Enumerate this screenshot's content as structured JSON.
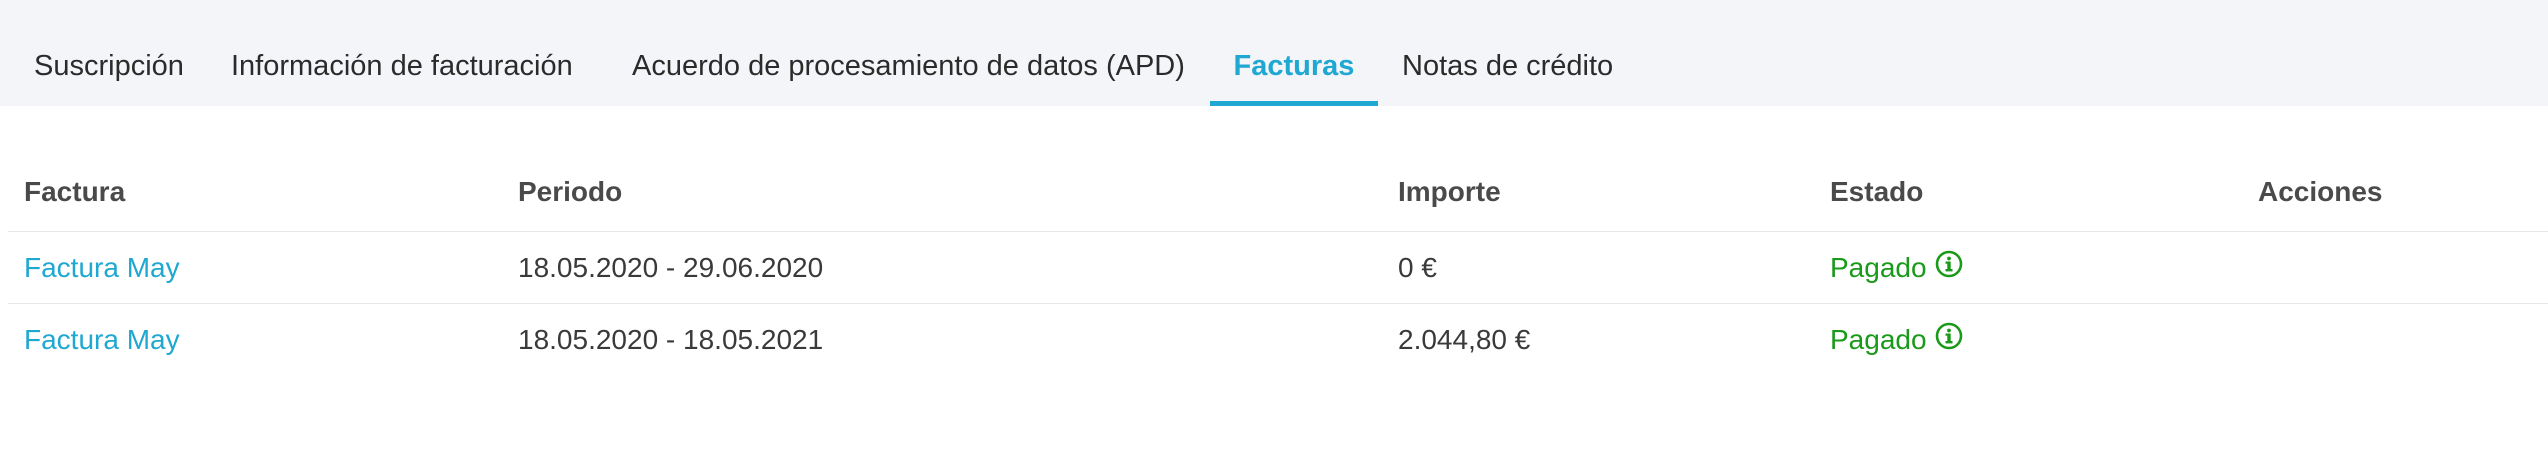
{
  "tabs": [
    {
      "label": "Suscripción",
      "active": false
    },
    {
      "label": "Información de facturación",
      "active": false
    },
    {
      "label": "Acuerdo de procesamiento de datos (APD)",
      "active": false
    },
    {
      "label": "Facturas",
      "active": true
    },
    {
      "label": "Notas de crédito",
      "active": false
    }
  ],
  "table": {
    "columns": [
      "Factura",
      "Periodo",
      "Importe",
      "Estado",
      "Acciones"
    ],
    "rows": [
      {
        "invoice": "Factura May",
        "period": "18.05.2020 - 29.06.2020",
        "amount": "0 €",
        "status": "Pagado",
        "status_icon": "info-icon"
      },
      {
        "invoice": "Factura May",
        "period": "18.05.2020 - 18.05.2021",
        "amount": "2.044,80 €",
        "status": "Pagado",
        "status_icon": "info-icon"
      }
    ]
  },
  "colors": {
    "accent": "#1ea8d2",
    "status_paid": "#1a9a1a",
    "tabbar_bg": "#f4f5f8"
  }
}
